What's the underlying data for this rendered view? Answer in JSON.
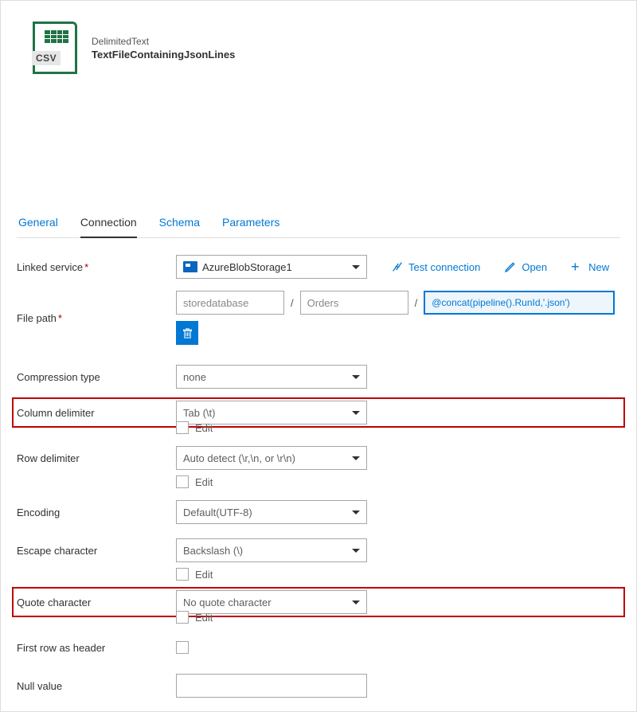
{
  "header": {
    "type_label": "DelimitedText",
    "title": "TextFileContainingJsonLines",
    "icon_text": "CSV"
  },
  "tabs": {
    "general": "General",
    "connection": "Connection",
    "schema": "Schema",
    "parameters": "Parameters"
  },
  "labels": {
    "linked_service": "Linked service",
    "file_path": "File path",
    "compression_type": "Compression type",
    "column_delimiter": "Column delimiter",
    "row_delimiter": "Row delimiter",
    "encoding": "Encoding",
    "escape_character": "Escape character",
    "quote_character": "Quote character",
    "first_row_as_header": "First row as header",
    "null_value": "Null value",
    "edit": "Edit"
  },
  "values": {
    "linked_service": "AzureBlobStorage1",
    "filepath_seg1": "storedatabase",
    "filepath_seg2": "Orders",
    "filepath_seg3": "@concat(pipeline().RunId,'.json')",
    "compression_type": "none",
    "column_delimiter": "Tab (\\t)",
    "row_delimiter": "Auto detect (\\r,\\n, or \\r\\n)",
    "encoding": "Default(UTF-8)",
    "escape_character": "Backslash (\\)",
    "quote_character": "No quote character"
  },
  "actions": {
    "test_connection": "Test connection",
    "open": "Open",
    "new": "New"
  }
}
